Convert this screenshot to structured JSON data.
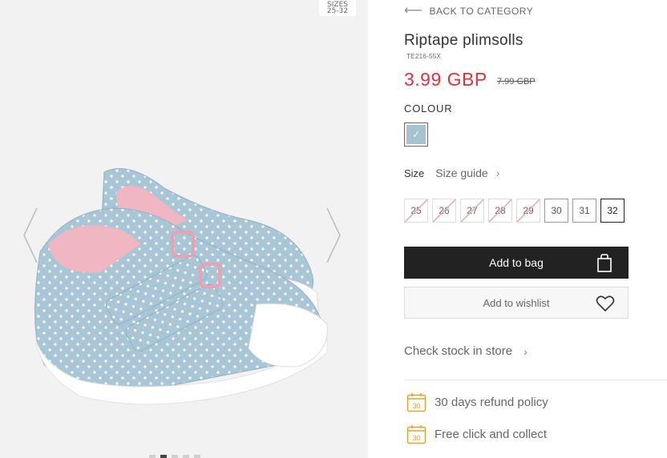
{
  "gallery": {
    "size_badge_line1": "SIZES",
    "size_badge_line2": "25-32",
    "prev_icon": "chevron-left-icon",
    "next_icon": "chevron-right-icon",
    "image_alt": "Blue polka dot riptape plimsolls with pink lining"
  },
  "nav": {
    "back_label": "BACK TO CATEGORY",
    "back_icon": "arrow-left-icon"
  },
  "product": {
    "title": "Riptape plimsolls",
    "sku": "TE216-55X",
    "price": "3.99 GBP",
    "old_price": "7.99 GBP",
    "price_color": "#e4303d"
  },
  "colour": {
    "label": "COLOUR",
    "selected_swatch": "#a7c2d1"
  },
  "size": {
    "label": "Size",
    "guide_label": "Size guide",
    "options": [
      {
        "value": "25",
        "available": false
      },
      {
        "value": "26",
        "available": false
      },
      {
        "value": "27",
        "available": false
      },
      {
        "value": "28",
        "available": false
      },
      {
        "value": "29",
        "available": false
      },
      {
        "value": "30",
        "available": true
      },
      {
        "value": "31",
        "available": true
      },
      {
        "value": "32",
        "available": true,
        "selected": true
      }
    ]
  },
  "actions": {
    "add_to_bag": "Add to bag",
    "add_to_wishlist": "Add to wishlist",
    "check_stock": "Check stock in store"
  },
  "features": [
    {
      "icon_text": "30",
      "label": "30 days refund policy"
    },
    {
      "icon_text": "30",
      "label": "Free click and collect"
    }
  ]
}
